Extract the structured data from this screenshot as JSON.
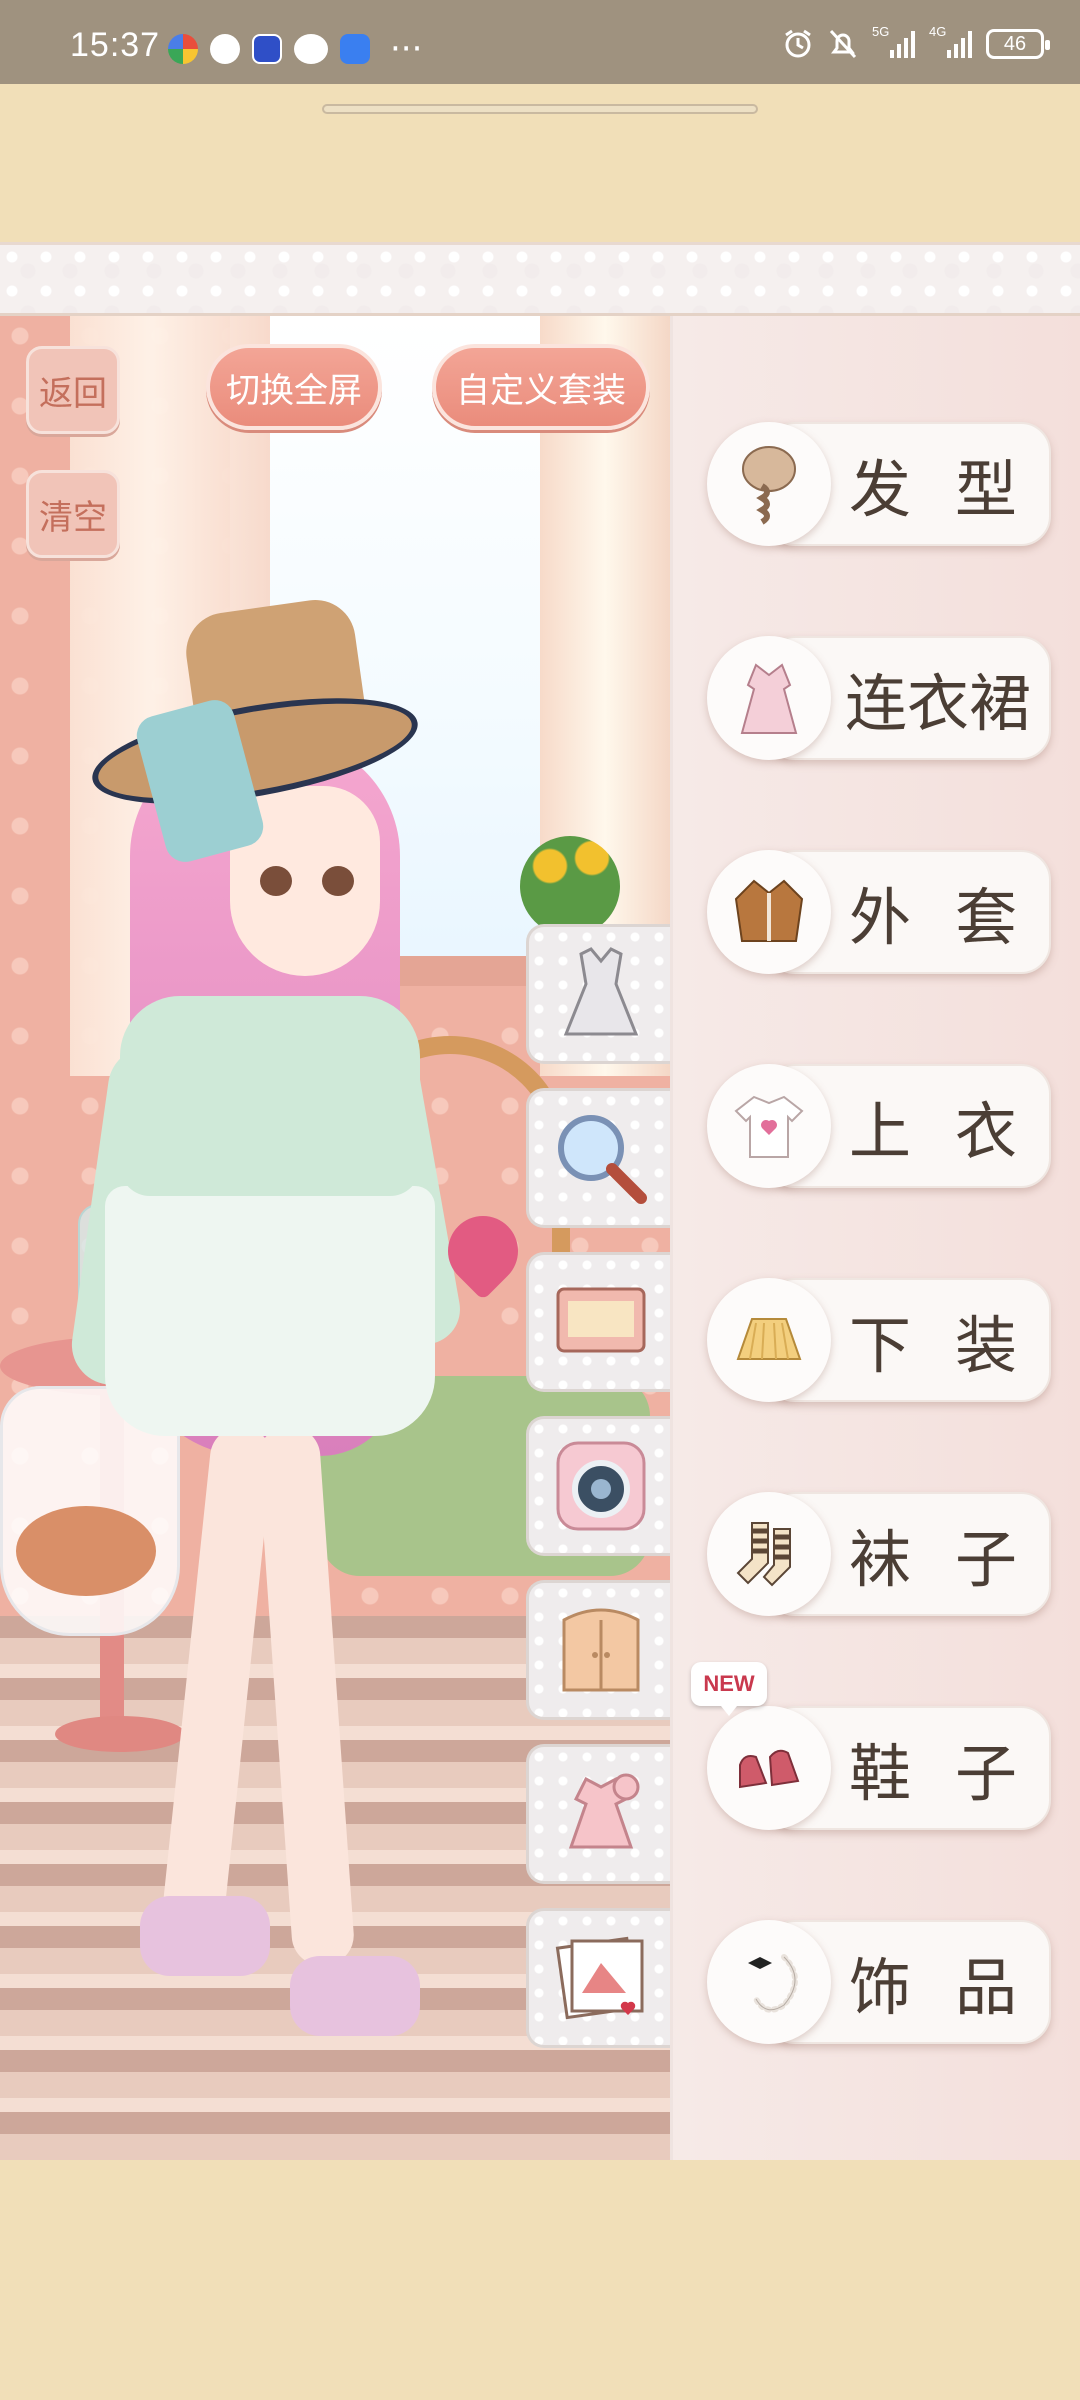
{
  "status_bar": {
    "time": "15:37",
    "more": "···",
    "network_1": "5G",
    "network_2": "4G",
    "battery": "46"
  },
  "controls": {
    "back": "返回",
    "clear": "清空",
    "fullscreen": "切换全屏",
    "custom_outfit": "自定义套装"
  },
  "categories": [
    {
      "label": "发型",
      "icon": "braid-hair-icon"
    },
    {
      "label": "连衣裙",
      "icon": "dress-icon"
    },
    {
      "label": "外套",
      "icon": "jacket-icon"
    },
    {
      "label": "上衣",
      "icon": "tshirt-icon"
    },
    {
      "label": "下装",
      "icon": "skirt-icon"
    },
    {
      "label": "袜子",
      "icon": "socks-icon"
    },
    {
      "label": "鞋子",
      "icon": "shoes-icon",
      "badge": "NEW"
    },
    {
      "label": "饰品",
      "icon": "necklace-icon"
    }
  ],
  "tools": [
    "dress-form-icon",
    "magnifier-icon",
    "scroll-background-icon",
    "camera-icon",
    "wardrobe-icon",
    "outfit-set-icon",
    "photo-album-icon"
  ],
  "colors": {
    "status_bar": "#9f927f",
    "page_background": "#f1dfb8",
    "button_pink": "#ea8c7c",
    "label_text": "#4b3e35",
    "new_badge": "#c9394e"
  }
}
